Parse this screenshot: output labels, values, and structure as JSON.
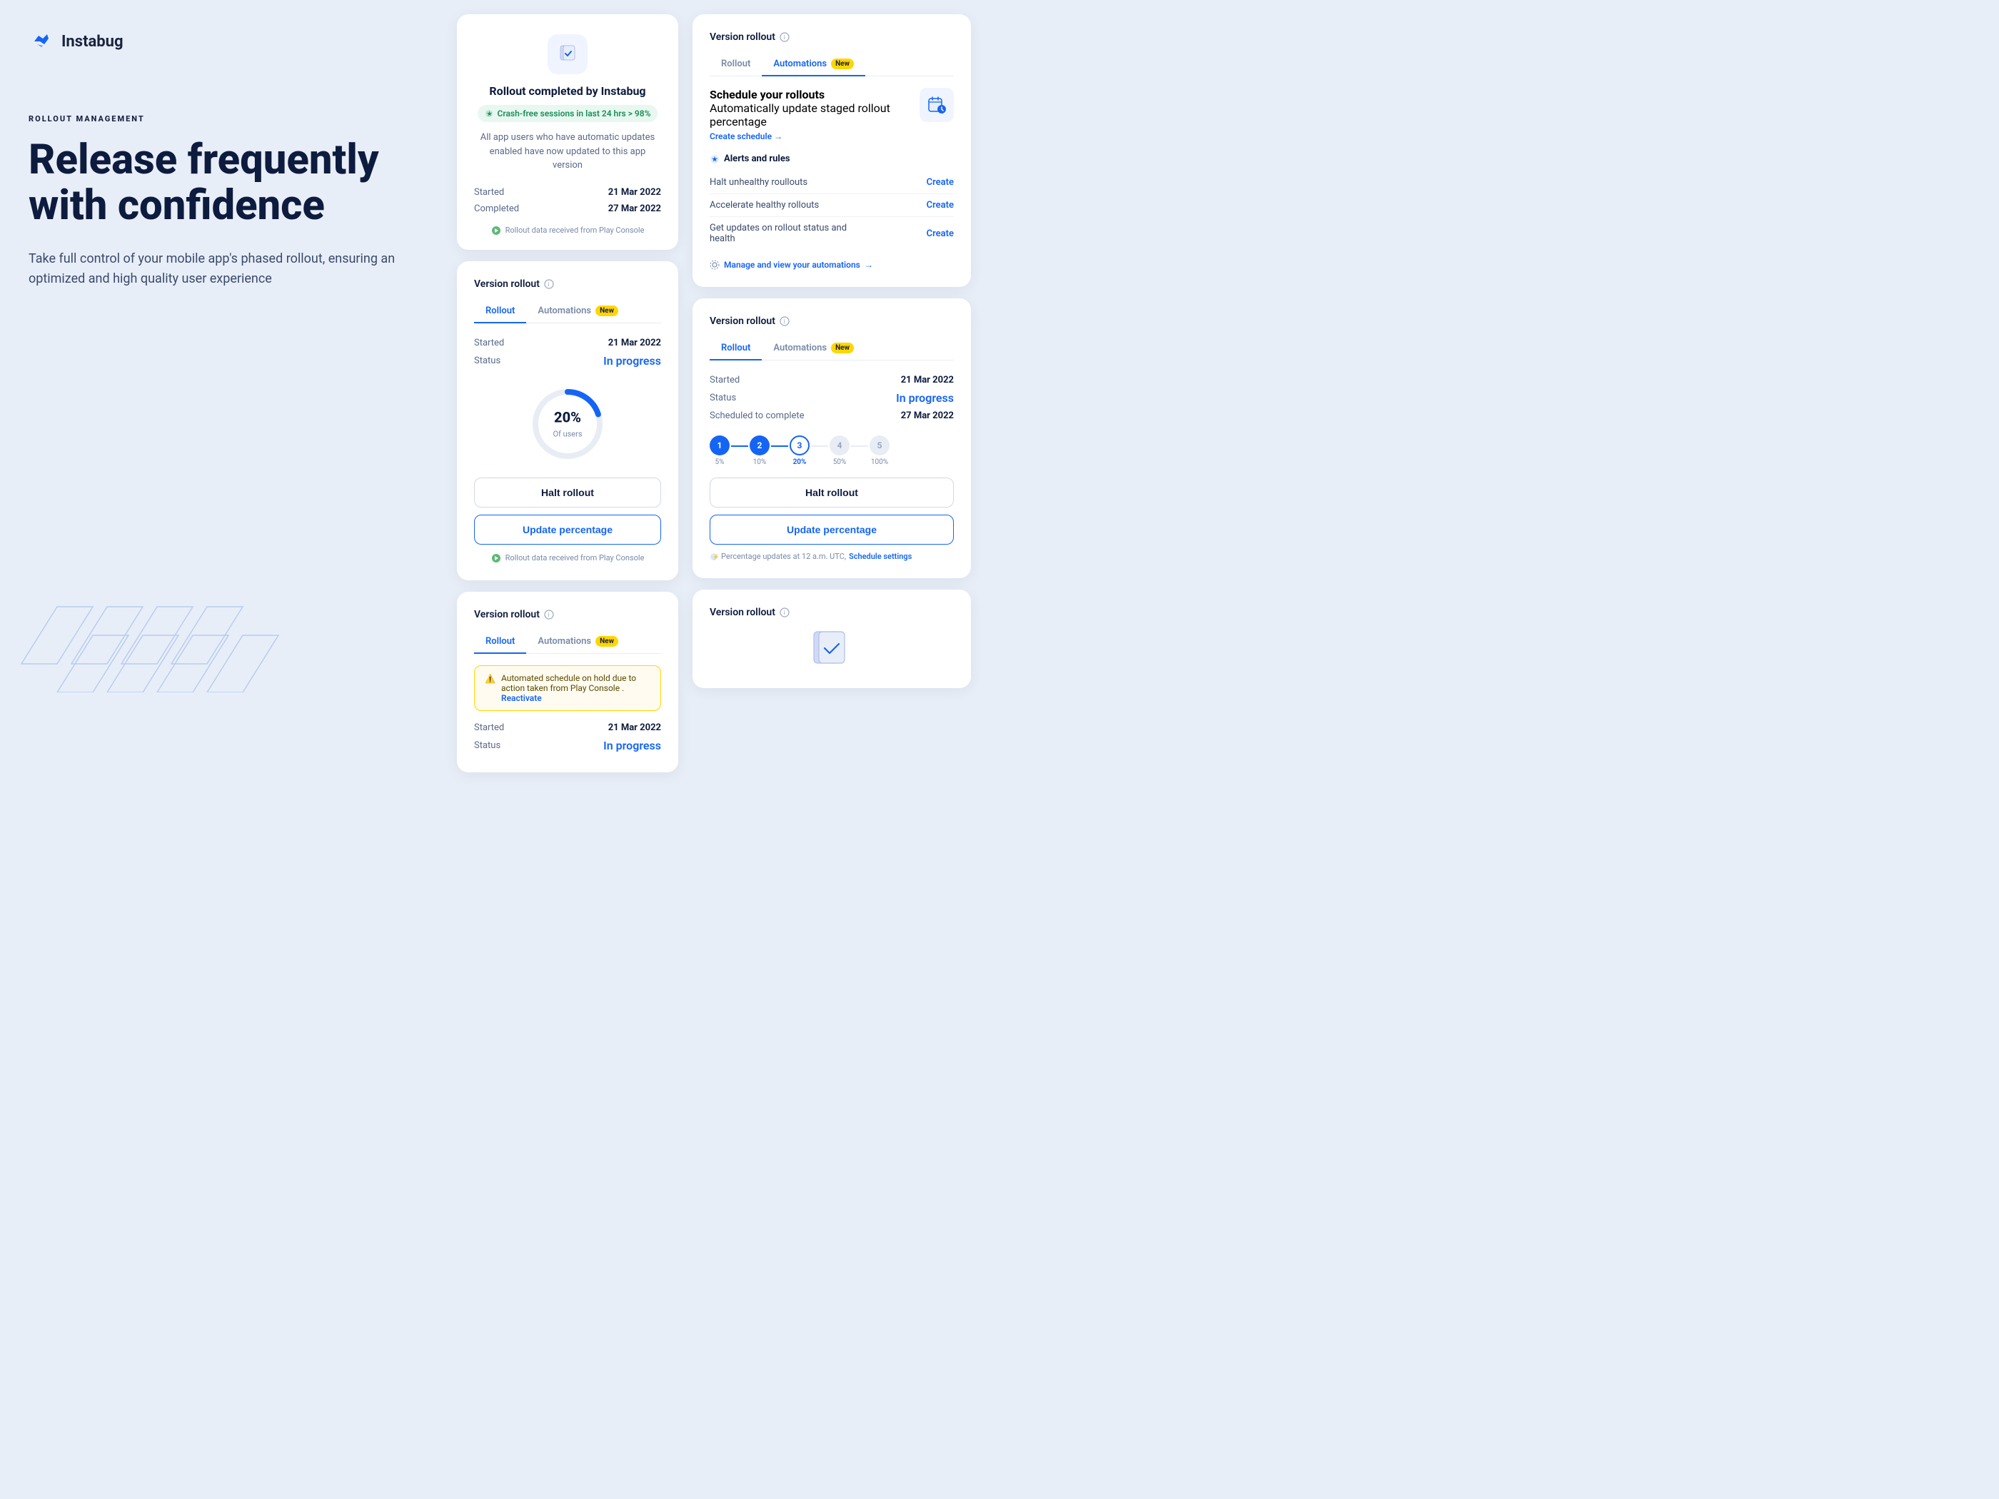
{
  "logo": {
    "name": "Instabug",
    "icon_color": "#1565f5"
  },
  "hero": {
    "badge": "ROLLOUT MANAGEMENT",
    "title": "Release frequently\nwith confidence",
    "subtitle": "Take full control of your mobile app's phased rollout,\nensuring an optimized and high quality user experience"
  },
  "card_completed": {
    "title": "Rollout completed by Instabug",
    "badge_text": "Crash-free sessions in last 24 hrs > 98%",
    "description": "All app users who have automatic updates enabled have now updated to this app version",
    "started_label": "Started",
    "started_value": "21 Mar 2022",
    "completed_label": "Completed",
    "completed_value": "27 Mar 2022",
    "play_note": "Rollout data received from Play Console"
  },
  "card_rollout_middle": {
    "title": "Version rollout",
    "tab_rollout": "Rollout",
    "tab_automations": "Automations",
    "new_label": "New",
    "started_label": "Started",
    "started_value": "21 Mar 2022",
    "status_label": "Status",
    "status_value": "In progress",
    "progress_pct": "20%",
    "progress_sublabel": "Of users",
    "btn_halt": "Halt rollout",
    "btn_update": "Update percentage",
    "play_note": "Rollout data received from Play Console"
  },
  "card_rollout_bottom_middle": {
    "title": "Version rollout",
    "tab_rollout": "Rollout",
    "tab_automations": "Automations",
    "new_label": "New",
    "warning_text": "Automated schedule on hold due to action taken from Play Console .",
    "reactivate_link": "Reactivate",
    "started_label": "Started",
    "started_value": "21 Mar 2022",
    "status_label": "Status",
    "status_value": "In progress"
  },
  "card_automations_right": {
    "title": "Version rollout",
    "tab_rollout": "Rollout",
    "tab_automations": "Automations",
    "new_label": "New",
    "schedule_title": "Schedule your rollouts",
    "schedule_desc": "Automatically update staged rollout percentage",
    "create_schedule": "Create schedule →",
    "alerts_title": "Alerts and rules",
    "alert1": "Halt unhealthy roullouts",
    "alert2": "Accelerate healthy rollouts",
    "alert3": "Get updates on rollout status and health",
    "create_label": "Create",
    "manage_text": "Manage and view your automations",
    "manage_arrow": "→"
  },
  "card_rollout_right": {
    "title": "Version rollout",
    "tab_rollout": "Rollout",
    "tab_automations": "Automations",
    "new_label": "New",
    "started_label": "Started",
    "started_value": "21 Mar 2022",
    "status_label": "Status",
    "status_value": "In progress",
    "scheduled_label": "Scheduled to complete",
    "scheduled_value": "27 Mar 2022",
    "steps": [
      {
        "num": "1",
        "pct": "5%",
        "state": "done"
      },
      {
        "num": "2",
        "pct": "10%",
        "state": "done"
      },
      {
        "num": "3",
        "pct": "20%",
        "state": "active"
      },
      {
        "num": "4",
        "pct": "50%",
        "state": "inactive"
      },
      {
        "num": "5",
        "pct": "100%",
        "state": "inactive"
      }
    ],
    "btn_halt": "Halt rollout",
    "btn_update": "Update percentage",
    "pct_note": "Percentage updates at 12 a.m. UTC,",
    "schedule_link": "Schedule settings"
  },
  "card_version_bottom_right": {
    "title": "Version rollout"
  }
}
